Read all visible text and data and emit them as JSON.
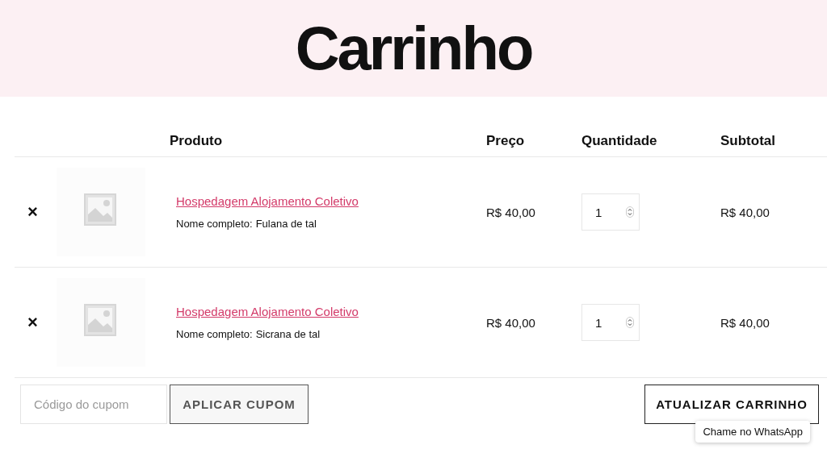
{
  "page_title": "Carrinho",
  "table": {
    "columns": [
      "Produto",
      "Preço",
      "Quantidade",
      "Subtotal"
    ],
    "rows": [
      {
        "remove": "×",
        "product": "Hospedagem Alojamento Coletivo",
        "meta_label": "Nome completo:",
        "meta_value": "Fulana de tal",
        "price": "R$ 40,00",
        "quantity": "1",
        "subtotal": "R$ 40,00"
      },
      {
        "remove": "×",
        "product": "Hospedagem Alojamento Coletivo",
        "meta_label": "Nome completo:",
        "meta_value": "Sicrana de tal",
        "price": "R$ 40,00",
        "quantity": "1",
        "subtotal": "R$ 40,00"
      }
    ]
  },
  "coupon": {
    "placeholder": "Código do cupom",
    "apply_button": "APLICAR CUPOM"
  },
  "update_button": "ATUALIZAR CARRINHO",
  "whatsapp_tooltip": "Chame no WhatsApp"
}
